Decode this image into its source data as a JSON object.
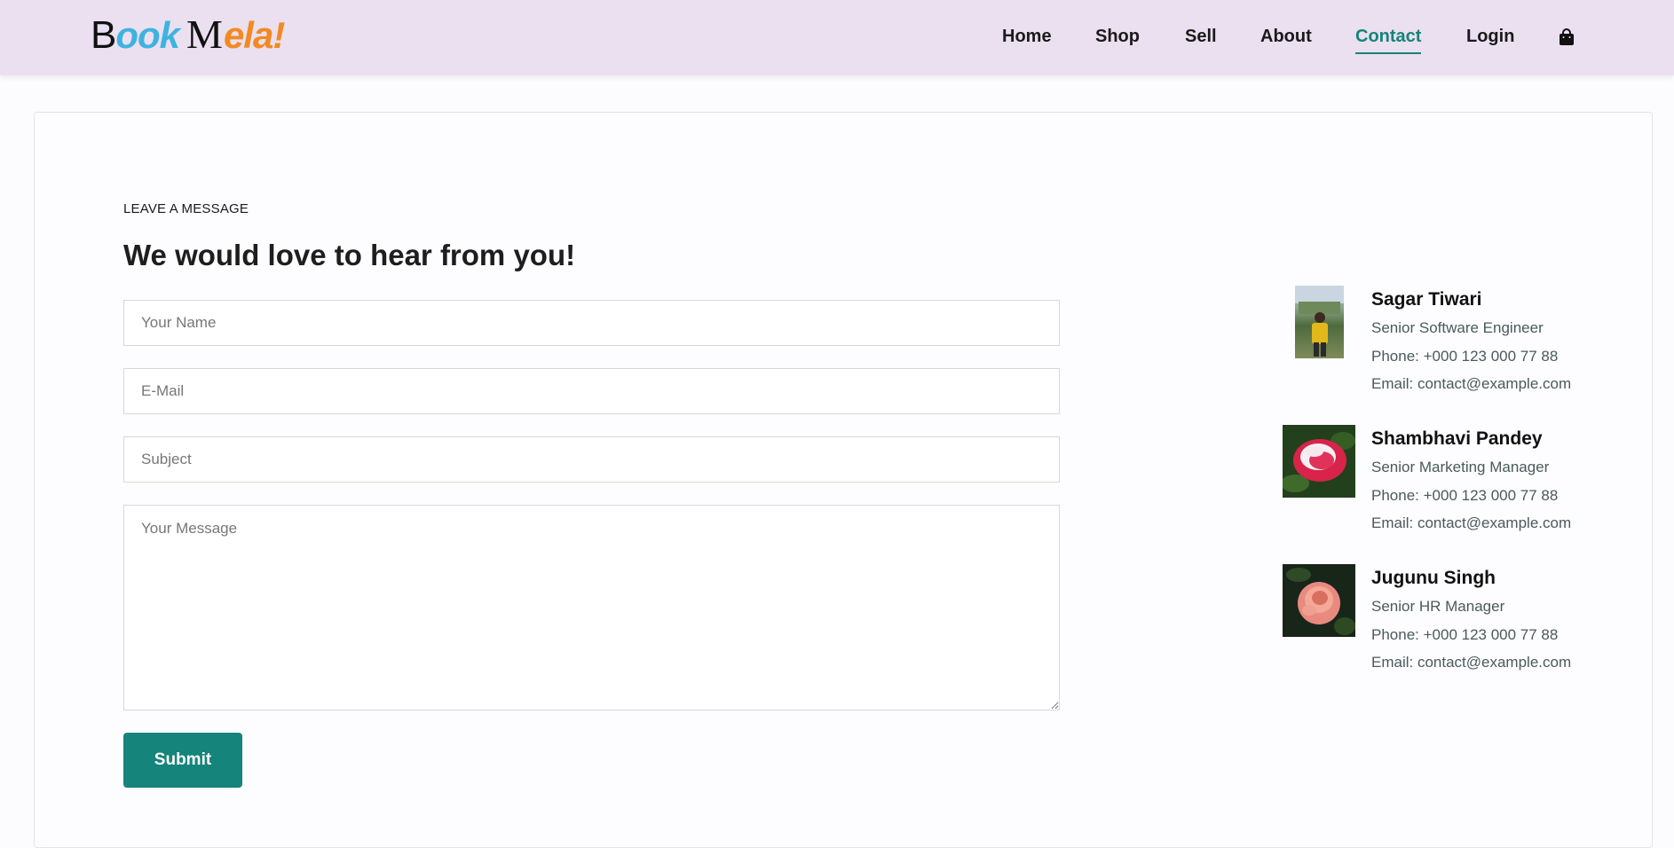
{
  "brand": {
    "logo_b": "B",
    "logo_ook": "ook",
    "logo_m": "M",
    "logo_ela": "ela!"
  },
  "nav": {
    "items": [
      "Home",
      "Shop",
      "Sell",
      "About",
      "Contact",
      "Login"
    ],
    "active": "Contact",
    "cart_icon": "shopping-bag-icon"
  },
  "form": {
    "eyebrow": "LEAVE A MESSAGE",
    "heading": "We would love to hear from you!",
    "name_placeholder": "Your Name",
    "email_placeholder": "E-Mail",
    "subject_placeholder": "Subject",
    "message_placeholder": "Your Message",
    "submit_label": "Submit"
  },
  "contacts": [
    {
      "name": "Sagar Tiwari",
      "role": "Senior Software Engineer",
      "phone": "Phone: +000 123 000 77 88",
      "email": "Email: contact@example.com",
      "photo": "person-photo"
    },
    {
      "name": "Shambhavi Pandey",
      "role": "Senior Marketing Manager",
      "phone": "Phone: +000 123 000 77 88",
      "email": "Email: contact@example.com",
      "photo": "red-rose-photo"
    },
    {
      "name": "Jugunu Singh",
      "role": "Senior HR Manager",
      "phone": "Phone: +000 123 000 77 88",
      "email": "Email: contact@example.com",
      "photo": "pink-rose-photo"
    }
  ],
  "colors": {
    "header_bg": "#ebe0f0",
    "accent": "#15847a",
    "logo_blue": "#3fb3e0",
    "logo_orange": "#f28a22"
  }
}
